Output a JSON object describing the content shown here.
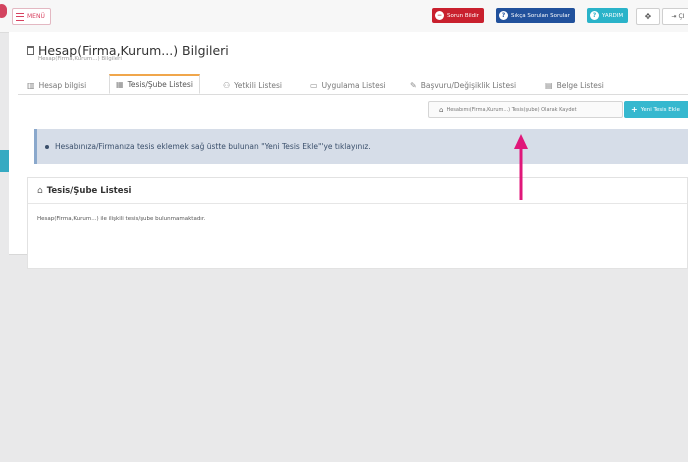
{
  "topbar": {
    "menu_label": "MENÜ",
    "report_issue_label": "Sorun Bildir",
    "faq_label": "Sıkça Sorulan Sorular",
    "help_label": "YARDIM",
    "exit_label": "ÇI"
  },
  "page": {
    "title": "Hesap(Firma,Kurum...) Bilgileri",
    "subtitle": "Hesap(Firma,Kurum...) Bilgileri"
  },
  "tabs": [
    {
      "label": "Hesap bilgisi",
      "icon": "document-icon",
      "active": false
    },
    {
      "label": "Tesis/Şube Listesi",
      "icon": "building-icon",
      "active": true
    },
    {
      "label": "Yetkili Listesi",
      "icon": "users-icon",
      "active": false
    },
    {
      "label": "Uygulama Listesi",
      "icon": "monitor-icon",
      "active": false
    },
    {
      "label": "Başvuru/Değişiklik Listesi",
      "icon": "edit-icon",
      "active": false
    },
    {
      "label": "Belge Listesi",
      "icon": "file-icon",
      "active": false
    }
  ],
  "actions": {
    "save_as_facility_label": "Hesabımı(Firma,Kurum...) Tesis(şube) Olarak Kaydet",
    "add_facility_label": "Yeni Tesis Ekle"
  },
  "alert": {
    "message": "Hesabınıza/Firmanıza tesis eklemek sağ üstte bulunan \"Yeni Tesis Ekle\"'ye tıklayınız."
  },
  "facility_list": {
    "heading": "Tesis/Şube Listesi",
    "empty_message": "Hesap(Firma,Kurum...) ile ilişkili tesis/şube bulunmamaktadır."
  },
  "colors": {
    "accent_pink": "#e0177a",
    "report_red": "#c9202e",
    "faq_blue": "#21519c",
    "help_teal": "#2ab3c9",
    "active_tab_orange": "#f0a64b"
  }
}
